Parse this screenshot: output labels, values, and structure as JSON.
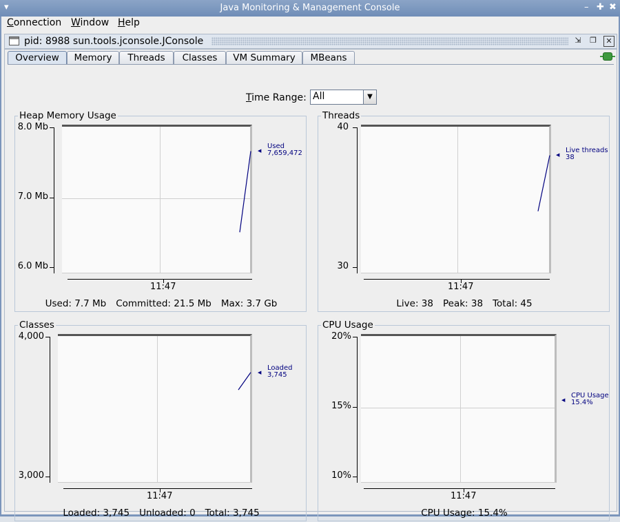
{
  "window": {
    "title": "Java Monitoring & Management Console"
  },
  "menubar": {
    "items": [
      "Connection",
      "Window",
      "Help"
    ]
  },
  "internal_frame": {
    "title": "pid: 8988 sun.tools.jconsole.JConsole"
  },
  "tabs": [
    "Overview",
    "Memory",
    "Threads",
    "Classes",
    "VM Summary",
    "MBeans"
  ],
  "active_tab": "Overview",
  "time_range": {
    "label": "Time Range:",
    "value": "All"
  },
  "panels": {
    "heap": {
      "title": "Heap Memory Usage",
      "y_ticks": [
        "8.0 Mb",
        "7.0 Mb",
        "6.0 Mb"
      ],
      "x_tick": "11:47",
      "legend_name": "Used",
      "legend_value": "7,659,472",
      "stats": {
        "used": "Used: 7.7 Mb",
        "committed": "Committed: 21.5 Mb",
        "max": "Max: 3.7 Gb"
      }
    },
    "threads": {
      "title": "Threads",
      "y_ticks": [
        "40",
        "30"
      ],
      "x_tick": "11:47",
      "legend_name": "Live threads",
      "legend_value": "38",
      "stats": {
        "live": "Live: 38",
        "peak": "Peak: 38",
        "total": "Total: 45"
      }
    },
    "classes": {
      "title": "Classes",
      "y_ticks": [
        "4,000",
        "3,000"
      ],
      "x_tick": "11:47",
      "legend_name": "Loaded",
      "legend_value": "3,745",
      "stats": {
        "loaded": "Loaded: 3,745",
        "unloaded": "Unloaded: 0",
        "total": "Total: 3,745"
      }
    },
    "cpu": {
      "title": "CPU Usage",
      "y_ticks": [
        "20%",
        "15%",
        "10%"
      ],
      "x_tick": "11:47",
      "legend_name": "CPU Usage",
      "legend_value": "15.4%",
      "stats": {
        "usage": "CPU Usage: 15.4%"
      }
    }
  },
  "colors": {
    "trace": "#00007f",
    "titlebar": "#7b95bb",
    "accent_plug": "#3f9a3f"
  },
  "icons": [
    "window-menu-icon",
    "minimize-icon",
    "maximize-icon",
    "close-icon",
    "frame-icon",
    "iconify-icon",
    "restore-icon",
    "frame-close-icon",
    "connection-status-icon",
    "dropdown-arrow-icon"
  ],
  "chart_data": [
    {
      "type": "line",
      "title": "Heap Memory Usage",
      "ylim": [
        6.0,
        8.0
      ],
      "yunit": "Mb",
      "series": [
        {
          "name": "Used",
          "x": [
            0,
            1
          ],
          "values": [
            6.5,
            7.66
          ]
        }
      ]
    },
    {
      "type": "line",
      "title": "Threads",
      "ylim": [
        30,
        40
      ],
      "series": [
        {
          "name": "Live threads",
          "x": [
            0,
            1
          ],
          "values": [
            34,
            38
          ]
        }
      ]
    },
    {
      "type": "line",
      "title": "Classes",
      "ylim": [
        3000,
        4000
      ],
      "series": [
        {
          "name": "Loaded",
          "x": [
            0,
            1
          ],
          "values": [
            3620,
            3745
          ]
        }
      ]
    },
    {
      "type": "line",
      "title": "CPU Usage",
      "ylim": [
        10,
        20
      ],
      "yunit": "%",
      "series": [
        {
          "name": "CPU Usage",
          "x": [
            1
          ],
          "values": [
            15.4
          ]
        }
      ]
    }
  ]
}
